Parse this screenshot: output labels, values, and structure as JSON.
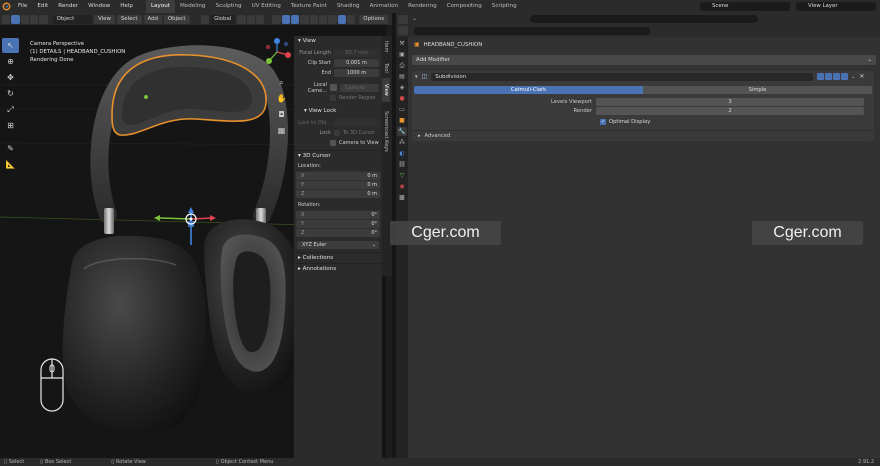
{
  "menu": [
    "File",
    "Edit",
    "Render",
    "Window",
    "Help"
  ],
  "workspaces": [
    "Layout",
    "Modeling",
    "Sculpting",
    "UV Editing",
    "Texture Paint",
    "Shading",
    "Animation",
    "Rendering",
    "Compositing",
    "Scripting"
  ],
  "active_workspace": "Layout",
  "scene": "Scene",
  "view_layer": "View Layer",
  "viewport_header": {
    "mode": "Object Mode",
    "menus": [
      "View",
      "Select",
      "Add",
      "Object"
    ],
    "transform": "Global",
    "options": "Options"
  },
  "viewport": {
    "title": "Camera Perspective",
    "collection": "(1) DETAILS | HEADBAND_CUSHION",
    "status": "Rendering Done"
  },
  "npanel": {
    "view_section": "View",
    "focal_length_label": "Focal Length",
    "focal_length": "50.7 mm",
    "clip_start_label": "Clip Start",
    "clip_start": "0.001 m",
    "end_label": "End",
    "end": "1000 m",
    "local_camera_label": "Local Came...",
    "local_camera_value": "Camera",
    "render_region": "Render Region",
    "view_lock_section": "View Lock",
    "lock_to_object_label": "Lock to Obj...",
    "lock_label": "Lock",
    "to_3d_cursor": "To 3D Cursor",
    "camera_to_view": "Camera to View",
    "cursor_section": "3D Cursor",
    "location_label": "Location:",
    "rotation_label": "Rotation:",
    "location": [
      {
        "axis": "X",
        "value": "0 m"
      },
      {
        "axis": "Y",
        "value": "0 m"
      },
      {
        "axis": "Z",
        "value": "0 m"
      }
    ],
    "rotation": [
      {
        "axis": "X",
        "value": "0°"
      },
      {
        "axis": "Y",
        "value": "0°"
      },
      {
        "axis": "Z",
        "value": "0°"
      }
    ],
    "rotation_mode": "XYZ Euler",
    "collections_section": "Collections",
    "annotations_section": "Annotations",
    "vertical_tabs": [
      "Item",
      "Tool",
      "View",
      "Screencast Keys"
    ]
  },
  "properties": {
    "object_name": "HEADBAND_CUSHION",
    "add_modifier": "Add Modifier",
    "modifier_name": "Subdivision",
    "catmull_clark": "Catmull-Clark",
    "simple": "Simple",
    "levels_viewport_label": "Levels Viewport",
    "levels_viewport": "3",
    "render_label": "Render",
    "render_value": "2",
    "optimal_display": "Optimal Display",
    "advanced": "Advanced"
  },
  "status_bar": {
    "select": "Select",
    "box_select": "Box Select",
    "rotate_view": "Rotate View",
    "context_menu": "Object Context Menu",
    "version": "2.91.2"
  },
  "watermark": "Cger.com",
  "colors": {
    "accent_blue": "#4a73b5",
    "selection_orange": "#e8912c",
    "axis_red": "#e0434f",
    "axis_green": "#7cc23a",
    "axis_blue": "#3f84e0"
  }
}
